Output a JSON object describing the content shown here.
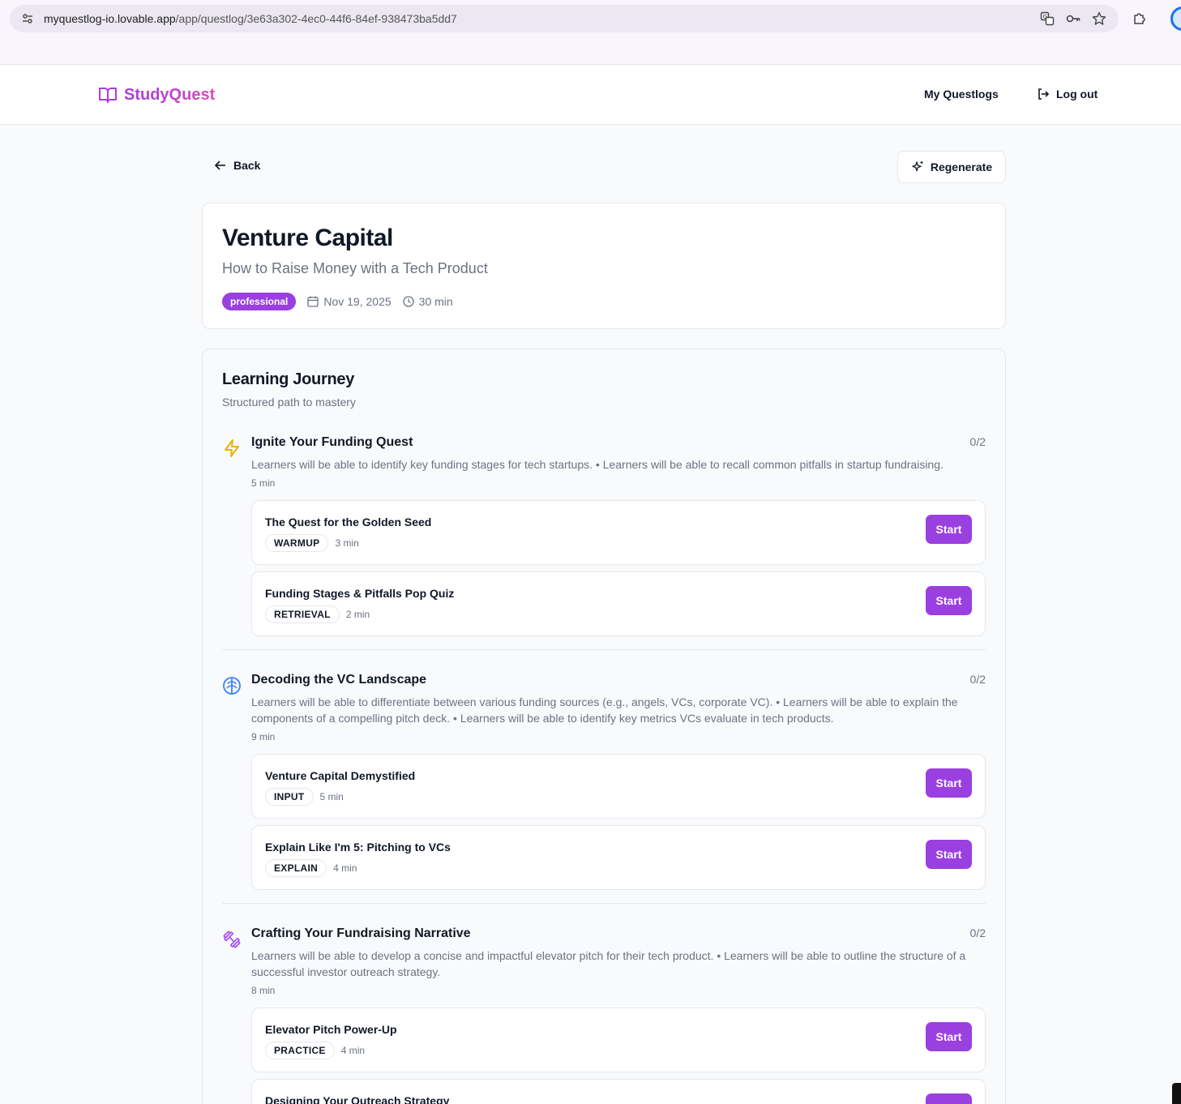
{
  "browser": {
    "url_host": "myquestlog-io.lovable.app",
    "url_path": "/app/questlog/3e63a302-4ec0-44f6-84ef-938473ba5dd7"
  },
  "header": {
    "logo_text": "StudyQuest",
    "nav": {
      "my_questlogs": "My Questlogs",
      "logout": "Log out"
    }
  },
  "actions": {
    "back": "Back",
    "regenerate": "Regenerate"
  },
  "quest": {
    "title": "Venture Capital",
    "subtitle": "How to Raise Money with a Tech Product",
    "level": "professional",
    "date": "Nov 19, 2025",
    "duration": "30 min"
  },
  "journey": {
    "title": "Learning Journey",
    "subtitle": "Structured path to mastery",
    "modules": [
      {
        "icon": "lightning-icon",
        "icon_color": "#eab308",
        "title": "Ignite Your Funding Quest",
        "progress": "0/2",
        "description": "Learners will be able to identify key funding stages for tech startups. • Learners will be able to recall common pitfalls in startup fundraising.",
        "time": "5 min",
        "activities": [
          {
            "title": "The Quest for the Golden Seed",
            "type": "WARMUP",
            "time": "3 min",
            "action": "Start"
          },
          {
            "title": "Funding Stages & Pitfalls Pop Quiz",
            "type": "RETRIEVAL",
            "time": "2 min",
            "action": "Start"
          }
        ]
      },
      {
        "icon": "brain-icon",
        "icon_color": "#3b82f6",
        "title": "Decoding the VC Landscape",
        "progress": "0/2",
        "description": "Learners will be able to differentiate between various funding sources (e.g., angels, VCs, corporate VC). • Learners will be able to explain the components of a compelling pitch deck. • Learners will be able to identify key metrics VCs evaluate in tech products.",
        "time": "9 min",
        "activities": [
          {
            "title": "Venture Capital Demystified",
            "type": "INPUT",
            "time": "5 min",
            "action": "Start"
          },
          {
            "title": "Explain Like I'm 5: Pitching to VCs",
            "type": "EXPLAIN",
            "time": "4 min",
            "action": "Start"
          }
        ]
      },
      {
        "icon": "dumbbell-icon",
        "icon_color": "#a855f7",
        "title": "Crafting Your Fundraising Narrative",
        "progress": "0/2",
        "description": "Learners will be able to develop a concise and impactful elevator pitch for their tech product. • Learners will be able to outline the structure of a successful investor outreach strategy.",
        "time": "8 min",
        "activities": [
          {
            "title": "Elevator Pitch Power-Up",
            "type": "PRACTICE",
            "time": "4 min",
            "action": "Start"
          },
          {
            "title": "Designing Your Outreach Strategy",
            "type": "",
            "time": "",
            "action": "Start"
          }
        ]
      }
    ]
  },
  "colors": {
    "accent": "#9a3fe0",
    "brand_gradient_start": "#a73de0",
    "brand_gradient_end": "#d64bbf"
  }
}
